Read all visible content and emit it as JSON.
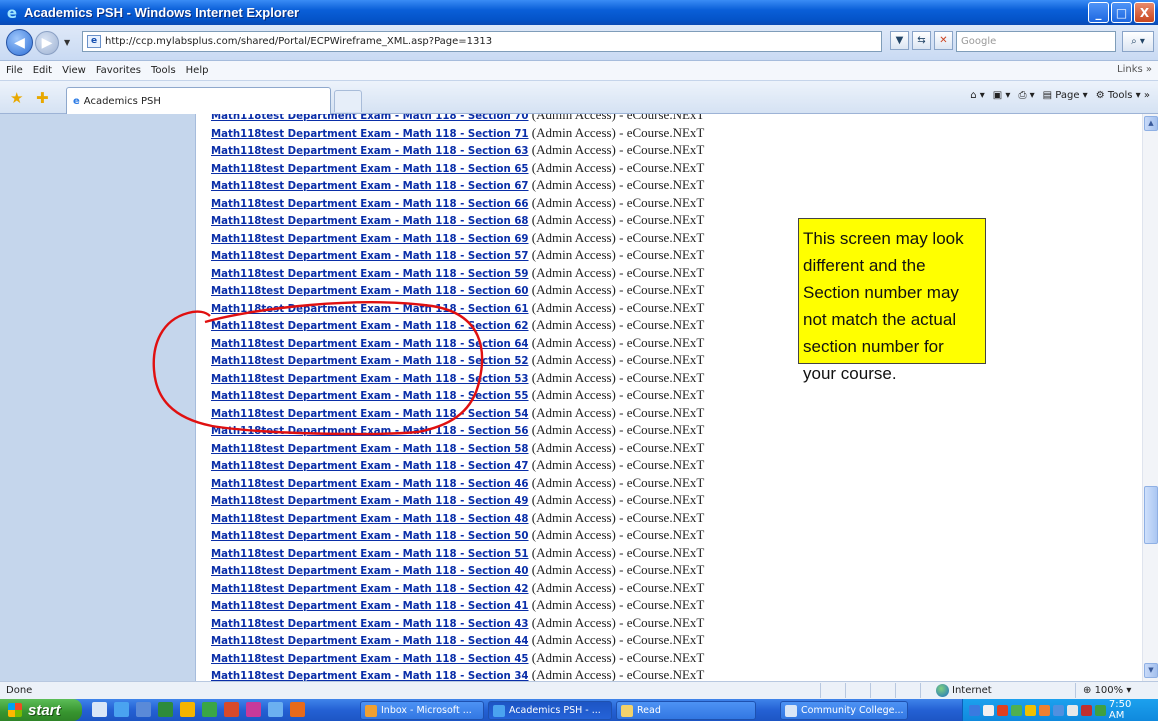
{
  "window": {
    "title": "Academics PSH - Windows Internet Explorer",
    "min_label": "_",
    "max_label": "□",
    "close_label": "X"
  },
  "address": {
    "url": "http://ccp.mylabsplus.com/shared/Portal/ECPWireframe_XML.asp?Page=1313",
    "search_placeholder": "Google"
  },
  "menu": {
    "items": [
      "File",
      "Edit",
      "View",
      "Favorites",
      "Tools",
      "Help"
    ],
    "links_label": "Links"
  },
  "tabs": {
    "active_tab": "Academics PSH",
    "page_label": "Page",
    "tools_label": "Tools"
  },
  "list": {
    "link_prefix": "Math118test Department Exam - Math 118 - Section ",
    "suffix": " (Admin Access) - eCourse.NExT",
    "sections": [
      "70",
      "71",
      "63",
      "65",
      "67",
      "66",
      "68",
      "69",
      "57",
      "59",
      "60",
      "61",
      "62",
      "64",
      "52",
      "53",
      "55",
      "54",
      "56",
      "58",
      "47",
      "46",
      "49",
      "48",
      "50",
      "51",
      "40",
      "42",
      "41",
      "43",
      "44",
      "45",
      "34"
    ]
  },
  "callout": {
    "text": "This screen may look different and the Section number may not match the actual section number for your course.",
    "color": "#ffff00"
  },
  "annotation": {
    "color": "#e01010"
  },
  "status": {
    "text": "Done",
    "zone": "Internet",
    "zoom": "100%"
  },
  "taskbar": {
    "start_label": "start",
    "buttons": [
      "Inbox - Microsoft ...",
      "Academics PSH - ...",
      "Read",
      "Community College..."
    ],
    "clock": "7:50 AM"
  },
  "colors": {
    "link": "#0a2ea8",
    "left_panel": "#c5d6ec"
  }
}
